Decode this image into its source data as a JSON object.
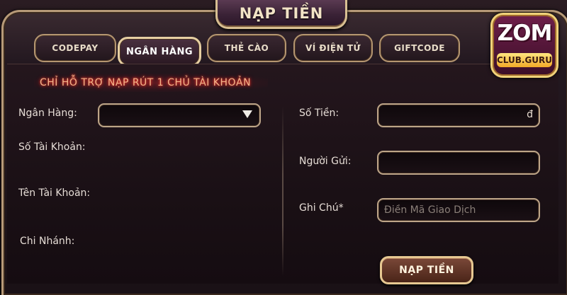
{
  "dialog": {
    "title": "NẠP TIỀN"
  },
  "logo": {
    "line1": "ZOM",
    "line2": "CLUB.GURU"
  },
  "tabs": [
    {
      "label": "CODEPAY",
      "active": false
    },
    {
      "label": "NGÂN HÀNG",
      "active": true
    },
    {
      "label": "THẺ CÀO",
      "active": false
    },
    {
      "label": "VÍ ĐIỆN TỬ",
      "active": false
    },
    {
      "label": "GIFTCODE",
      "active": false
    }
  ],
  "notice": "CHỈ HỖ TRỢ NẠP RÚT 1 CHỦ TÀI KHOẢN",
  "left_form": {
    "bank_label": "Ngân Hàng:",
    "bank_value": "",
    "account_number_label": "Số Tài Khoản:",
    "account_name_label": "Tên Tài Khoản:",
    "branch_label": "Chi Nhánh:"
  },
  "right_form": {
    "amount_label": "Số Tiền:",
    "amount_value": "",
    "currency": "đ",
    "sender_label": "Người Gửi:",
    "sender_value": "",
    "note_label": "Ghi Chú*",
    "note_placeholder": "Điền Mã Giao Dịch"
  },
  "submit_label": "NẠP TIỀN",
  "colors": {
    "accent_gold": "#d8bf92",
    "notice_red": "#f3b48a",
    "panel_bg": "#1c1216"
  }
}
